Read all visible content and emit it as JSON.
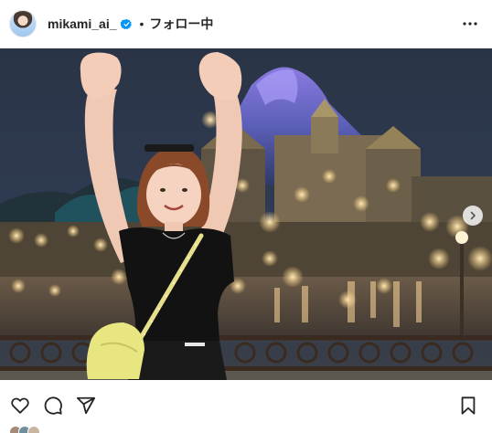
{
  "header": {
    "username": "mikami_ai_",
    "separator": "•",
    "follow_status": "フォロー中",
    "more_label": "…"
  },
  "icons": {
    "avatar": "profile-avatar",
    "verified": "verified-badge-icon",
    "more": "more-options-icon",
    "next": "chevron-right-icon",
    "like": "heart-icon",
    "comment": "comment-icon",
    "share": "send-icon",
    "save": "bookmark-icon"
  },
  "colors": {
    "verified_blue": "#0095f6",
    "text": "#262626"
  }
}
